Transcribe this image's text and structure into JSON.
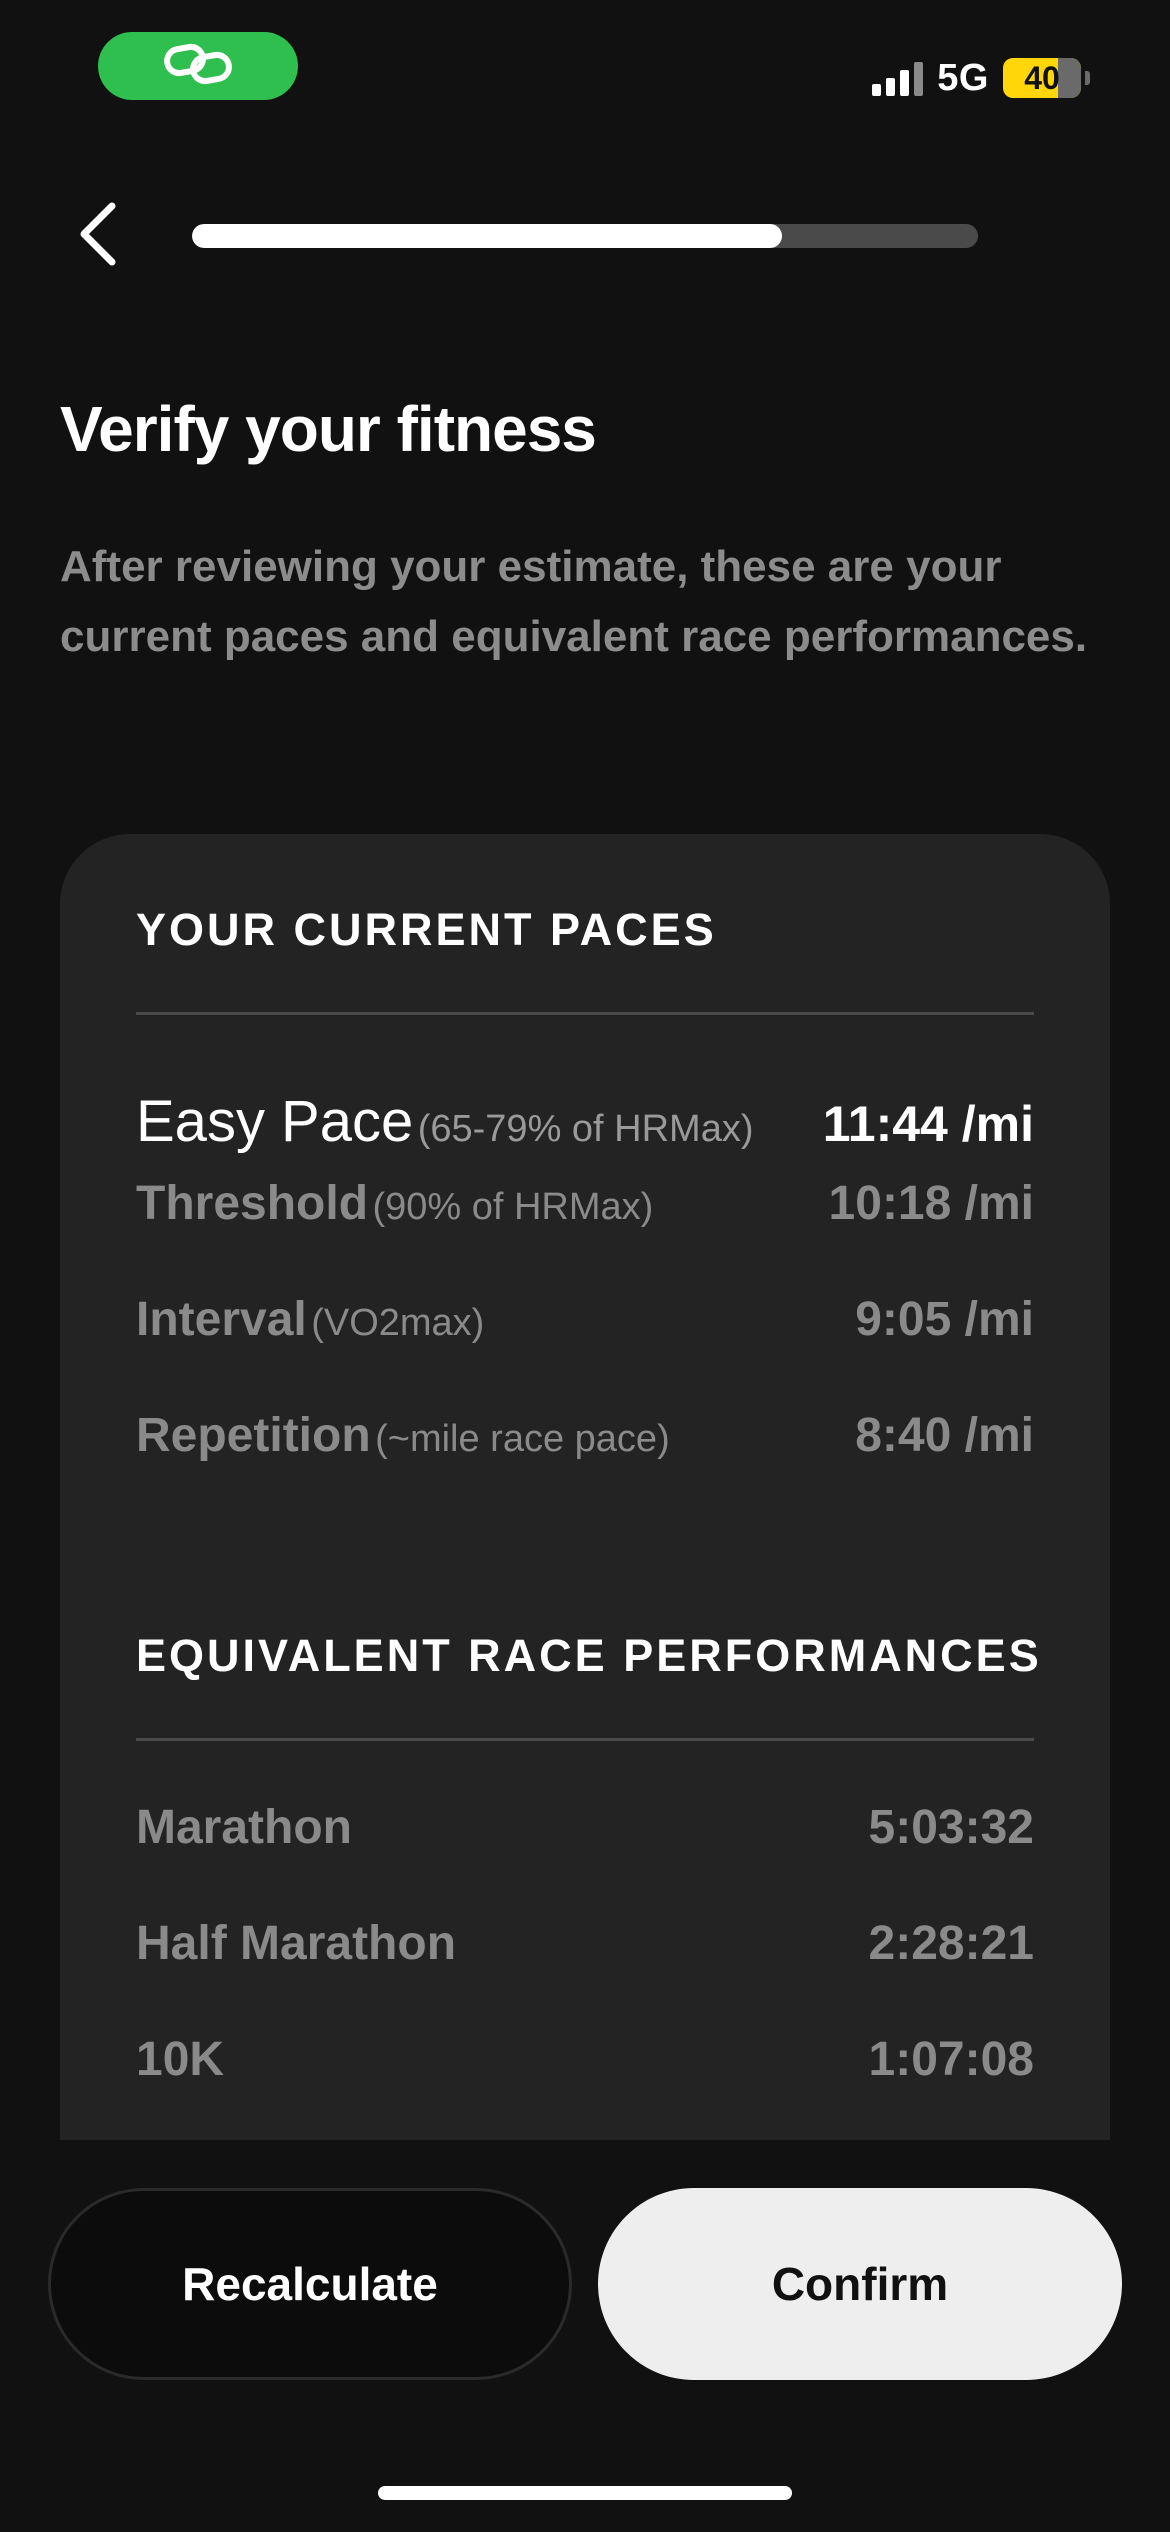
{
  "status_bar": {
    "network": "5G",
    "battery": "40",
    "battery_level_percent": 40,
    "signal_bars": 4,
    "link_pill_color": "#2fbf4e",
    "link_icon": "link-icon"
  },
  "nav": {
    "back_icon": "chevron-left-icon",
    "progress_percent": 75
  },
  "header": {
    "title": "Verify your fitness",
    "subtitle": "After reviewing your estimate, these are your current paces and equivalent race performances."
  },
  "paces": {
    "heading": "YOUR CURRENT PACES",
    "rows": [
      {
        "label": "Easy Pace",
        "note": "(65-79% of HRMax)",
        "value": "11:44 /mi"
      },
      {
        "label": "Threshold",
        "note": "(90% of HRMax)",
        "value": "10:18 /mi"
      },
      {
        "label": "Interval",
        "note": "(VO2max)",
        "value": "9:05 /mi"
      },
      {
        "label": "Repetition",
        "note": "(~mile race pace)",
        "value": "8:40 /mi"
      }
    ]
  },
  "races": {
    "heading": "EQUIVALENT RACE PERFORMANCES",
    "rows": [
      {
        "label": "Marathon",
        "value": "5:03:32"
      },
      {
        "label": "Half Marathon",
        "value": "2:28:21"
      },
      {
        "label": "10K",
        "value": "1:07:08"
      }
    ]
  },
  "actions": {
    "recalculate_label": "Recalculate",
    "confirm_label": "Confirm"
  },
  "colors": {
    "background": "#111111",
    "card": "#232323",
    "accent_green": "#2fbf4e",
    "battery_yellow": "#ffd60a"
  }
}
